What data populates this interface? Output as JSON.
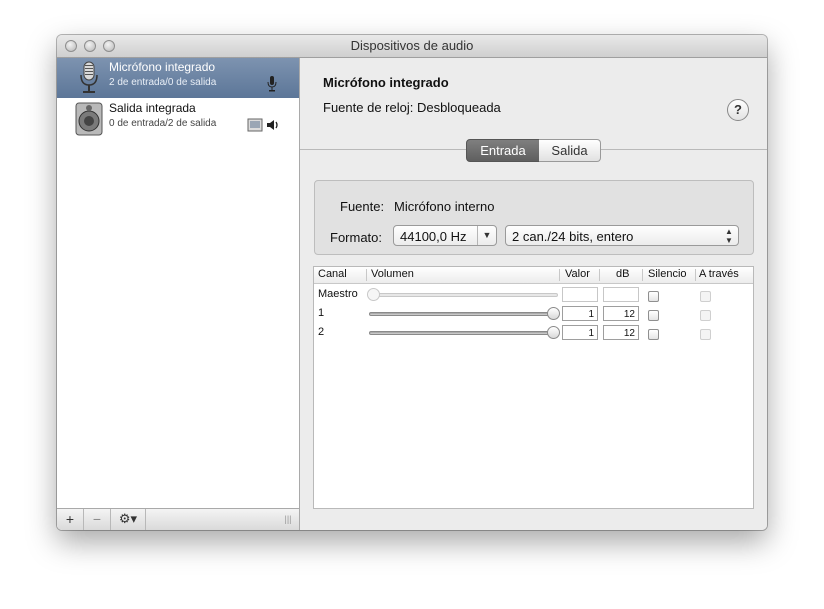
{
  "window": {
    "title": "Dispositivos de audio"
  },
  "sidebar": {
    "devices": [
      {
        "name": "Micrófono integrado",
        "channels": "2 de entrada/0 de salida",
        "icon": "microphone-icon",
        "selected": true
      },
      {
        "name": "Salida integrada",
        "channels": "0 de entrada/2 de salida",
        "icon": "speaker-icon",
        "selected": false
      }
    ],
    "toolbar": {
      "add_label": "+",
      "remove_label": "−",
      "gear_label": "⚙▾",
      "resize_label": "|||"
    }
  },
  "detail": {
    "device_title": "Micrófono integrado",
    "clock_source": "Fuente de reloj: Desbloqueada",
    "help_label": "?",
    "tabs": [
      {
        "label": "Entrada",
        "active": true
      },
      {
        "label": "Salida",
        "active": false
      }
    ],
    "source_label": "Fuente:",
    "source_value": "Micrófono interno",
    "format_label": "Formato:",
    "sample_rate": "44100,0 Hz",
    "format_value": "2 can./24 bits, entero"
  },
  "table": {
    "columns": [
      "Canal",
      "Volumen",
      "Valor",
      "dB",
      "Silencio",
      "A través"
    ],
    "rows": [
      {
        "channel": "Maestro",
        "volume": 0.0,
        "value": "",
        "db": "",
        "mute": false,
        "through": false,
        "enabled": false
      },
      {
        "channel": "1",
        "volume": 1.0,
        "value": "1",
        "db": "12",
        "mute": false,
        "through": false,
        "enabled": true
      },
      {
        "channel": "2",
        "volume": 1.0,
        "value": "1",
        "db": "12",
        "mute": false,
        "through": false,
        "enabled": true
      }
    ]
  },
  "colors": {
    "selection": "#6a83a6",
    "window_bg": "#ececec",
    "segment_active": "#6e6e6e"
  }
}
